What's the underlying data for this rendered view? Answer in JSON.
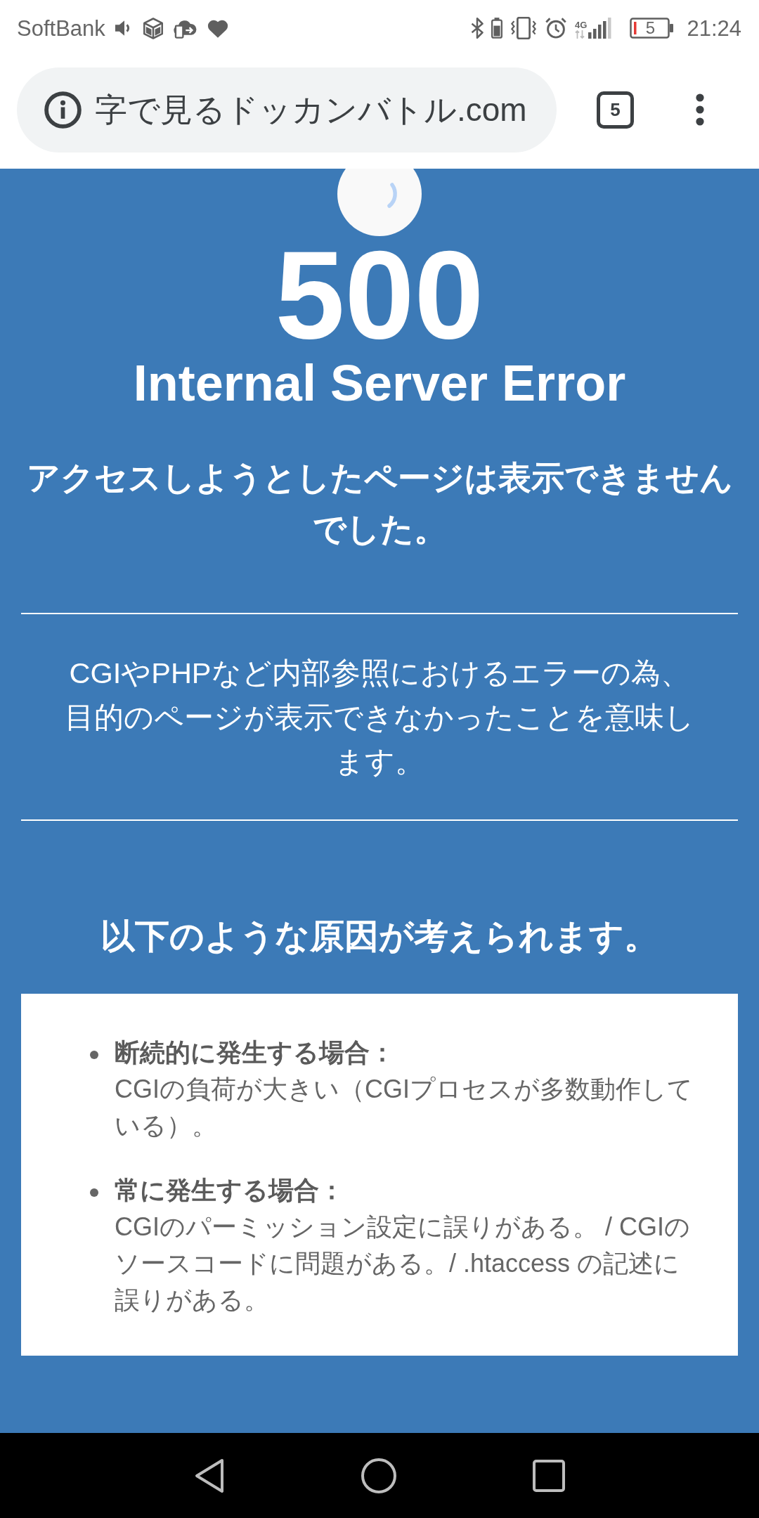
{
  "status_bar": {
    "carrier": "SoftBank",
    "network_type": "4G",
    "battery_reading": "5",
    "time": "21:24"
  },
  "browser_toolbar": {
    "url": "字で見るドッカンバトル.com",
    "tab_count": "5",
    "refreshing": true
  },
  "error_page": {
    "code": "500",
    "title": "Internal Server Error",
    "headline": "アクセスしようとしたページは表示できませんでした。",
    "description": "CGIやPHPなど内部参照におけるエラーの為、目的のページが表示できなかったことを意味します。",
    "causes_heading": "以下のような原因が考えられます。",
    "causes": [
      {
        "title": "断続的に発生する場合：",
        "text": "CGIの負荷が大きい（CGIプロセスが多数動作している）。"
      },
      {
        "title": "常に発生する場合：",
        "text": "CGIのパーミッション設定に誤りがある。 / CGIのソースコードに問題がある。/ .htaccess の記述に誤りがある。"
      }
    ]
  }
}
